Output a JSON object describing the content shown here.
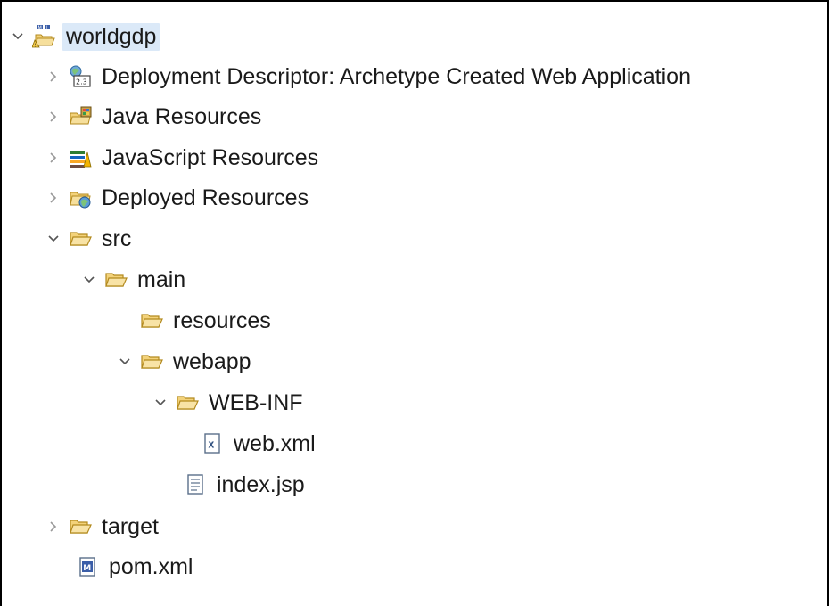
{
  "tree": {
    "nodes": [
      {
        "label": "worldgdp",
        "expanded": true,
        "icon": "maven-web-project-icon"
      },
      {
        "label": "Deployment Descriptor: Archetype Created Web Application",
        "expanded": false,
        "icon": "deployment-descriptor-icon"
      },
      {
        "label": "Java Resources",
        "expanded": false,
        "icon": "java-resources-icon"
      },
      {
        "label": "JavaScript Resources",
        "expanded": false,
        "icon": "javascript-resources-icon"
      },
      {
        "label": "Deployed Resources",
        "expanded": false,
        "icon": "deployed-resources-icon"
      },
      {
        "label": "src",
        "expanded": true,
        "icon": "folder-open-icon"
      },
      {
        "label": "main",
        "expanded": true,
        "icon": "folder-open-icon"
      },
      {
        "label": "resources",
        "expanded": null,
        "icon": "folder-open-icon"
      },
      {
        "label": "webapp",
        "expanded": true,
        "icon": "folder-open-icon"
      },
      {
        "label": "WEB-INF",
        "expanded": true,
        "icon": "folder-open-icon"
      },
      {
        "label": "web.xml",
        "expanded": null,
        "icon": "xml-file-icon"
      },
      {
        "label": "index.jsp",
        "expanded": null,
        "icon": "jsp-file-icon"
      },
      {
        "label": "target",
        "expanded": false,
        "icon": "folder-open-icon"
      },
      {
        "label": "pom.xml",
        "expanded": null,
        "icon": "maven-pom-icon"
      }
    ]
  },
  "colors": {
    "selection": "#dbe9f8",
    "folder": "#e8b84a",
    "text": "#1a1a1a"
  }
}
